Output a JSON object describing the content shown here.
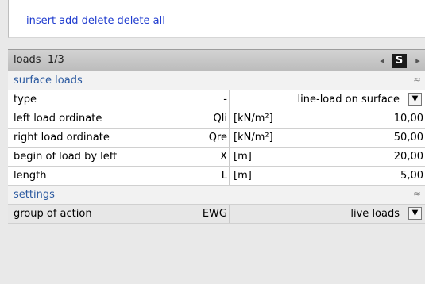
{
  "actions": {
    "insert": "insert",
    "add": "add",
    "delete": "delete",
    "delete_all": "delete all"
  },
  "panel": {
    "title": "loads",
    "counter": "1/3",
    "nav_prev": "◂",
    "nav_s": "S",
    "nav_next": "▸"
  },
  "sections": {
    "surface": "surface loads",
    "settings": "settings",
    "collapse_icon": "≈"
  },
  "rows": [
    {
      "label": "type",
      "symbol": "-",
      "unit": "",
      "value": "line-load on surface"
    },
    {
      "label": "left load ordinate",
      "symbol": "Qli",
      "unit": "[kN/m²]",
      "value": "10,00"
    },
    {
      "label": "right load ordinate",
      "symbol": "Qre",
      "unit": "[kN/m²]",
      "value": "50,00"
    },
    {
      "label": "begin of load by left",
      "symbol": "X",
      "unit": "[m]",
      "value": "20,00"
    },
    {
      "label": "length",
      "symbol": "L",
      "unit": "[m]",
      "value": "5,00"
    }
  ],
  "settings_rows": [
    {
      "label": "group of action",
      "symbol": "EWG",
      "value": "live loads"
    }
  ],
  "dropdown_icon": "▼"
}
